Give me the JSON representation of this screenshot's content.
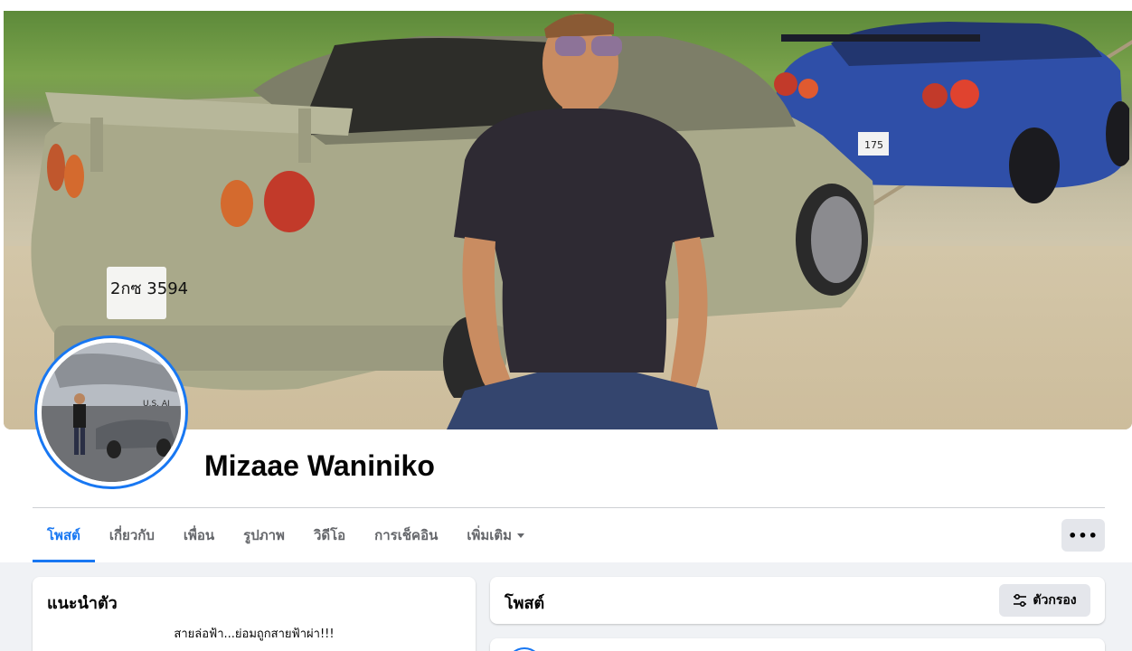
{
  "profile": {
    "name": "Mizaae Waniniko"
  },
  "tabs": [
    {
      "label": "โพสต์",
      "active": true
    },
    {
      "label": "เกี่ยวกับ",
      "active": false
    },
    {
      "label": "เพื่อน",
      "active": false
    },
    {
      "label": "รูปภาพ",
      "active": false
    },
    {
      "label": "วิดีโอ",
      "active": false
    },
    {
      "label": "การเช็คอิน",
      "active": false
    },
    {
      "label": "เพิ่มเติม",
      "active": false
    }
  ],
  "actions": {
    "more_label": "•••"
  },
  "intro": {
    "title": "แนะนำตัว",
    "bio": "สายล่อฟ้า...ย่อมถูกสายฟ้าผ่า!!!"
  },
  "posts": {
    "title": "โพสต์",
    "filter_label": "ตัวกรอง"
  },
  "cover": {
    "plate_silver": "2กซ 3594",
    "plate_blue": "175"
  },
  "avatar_photo": {
    "sign_text": "U.S. AI"
  },
  "colors": {
    "accent": "#1877f2",
    "page_bg": "#f0f2f5",
    "muted_text": "#65676b",
    "button_bg": "#e4e6eb"
  }
}
